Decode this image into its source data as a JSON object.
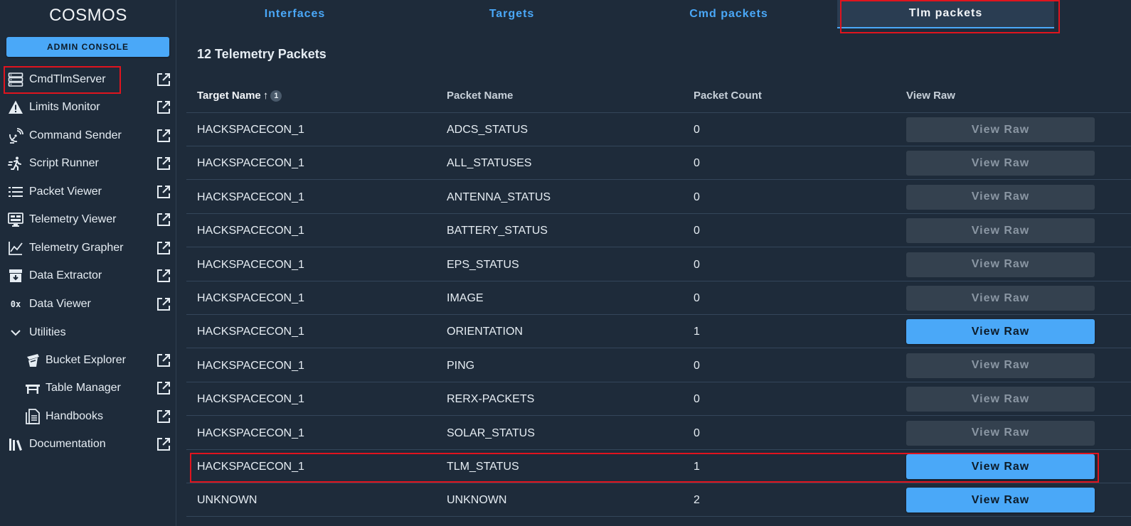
{
  "sidebar": {
    "app_title": "COSMOS",
    "admin_button": "ADMIN CONSOLE",
    "items": [
      {
        "label": "CmdTlmServer",
        "icon": "server-icon"
      },
      {
        "label": "Limits Monitor",
        "icon": "warning-icon"
      },
      {
        "label": "Command Sender",
        "icon": "satellite-dish-icon"
      },
      {
        "label": "Script Runner",
        "icon": "run-icon"
      },
      {
        "label": "Packet Viewer",
        "icon": "list-icon"
      },
      {
        "label": "Telemetry Viewer",
        "icon": "monitor-dashboard-icon"
      },
      {
        "label": "Telemetry Grapher",
        "icon": "chart-line-icon"
      },
      {
        "label": "Data Extractor",
        "icon": "archive-download-icon"
      },
      {
        "label": "Data Viewer",
        "icon": "hex-icon"
      }
    ],
    "utilities_group": {
      "label": "Utilities",
      "items": [
        {
          "label": "Bucket Explorer",
          "icon": "bucket-icon"
        },
        {
          "label": "Table Manager",
          "icon": "table-furniture-icon"
        },
        {
          "label": "Handbooks",
          "icon": "book-file-icon"
        }
      ]
    },
    "documentation": {
      "label": "Documentation",
      "icon": "library-icon"
    },
    "hex_glyph": "0x"
  },
  "tabs": [
    "Interfaces",
    "Targets",
    "Cmd packets",
    "Tlm packets"
  ],
  "active_tab": "Tlm packets",
  "card": {
    "title": "12 Telemetry Packets"
  },
  "table": {
    "headers": [
      "Target Name",
      "Packet Name",
      "Packet Count",
      "View Raw"
    ],
    "sort": {
      "arrow": "↑",
      "badge": "1"
    },
    "button_label": "View Raw",
    "rows": [
      {
        "target": "HACKSPACECON_1",
        "packet": "ADCS_STATUS",
        "count": "0",
        "enabled": false
      },
      {
        "target": "HACKSPACECON_1",
        "packet": "ALL_STATUSES",
        "count": "0",
        "enabled": false
      },
      {
        "target": "HACKSPACECON_1",
        "packet": "ANTENNA_STATUS",
        "count": "0",
        "enabled": false
      },
      {
        "target": "HACKSPACECON_1",
        "packet": "BATTERY_STATUS",
        "count": "0",
        "enabled": false
      },
      {
        "target": "HACKSPACECON_1",
        "packet": "EPS_STATUS",
        "count": "0",
        "enabled": false
      },
      {
        "target": "HACKSPACECON_1",
        "packet": "IMAGE",
        "count": "0",
        "enabled": false
      },
      {
        "target": "HACKSPACECON_1",
        "packet": "ORIENTATION",
        "count": "1",
        "enabled": true
      },
      {
        "target": "HACKSPACECON_1",
        "packet": "PING",
        "count": "0",
        "enabled": false
      },
      {
        "target": "HACKSPACECON_1",
        "packet": "RERX-PACKETS",
        "count": "0",
        "enabled": false
      },
      {
        "target": "HACKSPACECON_1",
        "packet": "SOLAR_STATUS",
        "count": "0",
        "enabled": false
      },
      {
        "target": "HACKSPACECON_1",
        "packet": "TLM_STATUS",
        "count": "1",
        "enabled": true
      },
      {
        "target": "UNKNOWN",
        "packet": "UNKNOWN",
        "count": "2",
        "enabled": true
      }
    ]
  },
  "colors": {
    "background": "#1e2b3a",
    "accent": "#4aa8f8",
    "highlight": "#e0141e",
    "disabled_button": "#34414f"
  }
}
